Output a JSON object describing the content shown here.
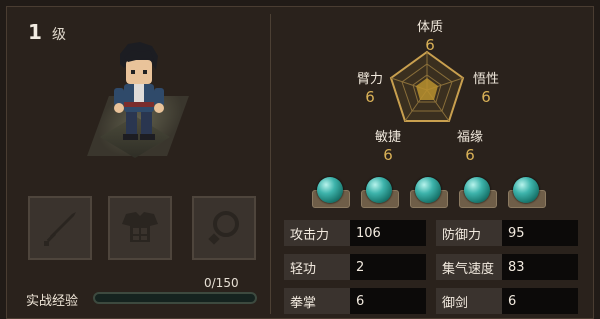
{
  "level": {
    "number": "1",
    "unit": "级"
  },
  "equipment_slots": [
    {
      "name": "weapon",
      "icon": "sword-icon"
    },
    {
      "name": "armor",
      "icon": "armor-icon"
    },
    {
      "name": "accessory",
      "icon": "necklace-icon"
    }
  ],
  "experience": {
    "label": "实战经验",
    "value": "0/150",
    "progress": 0.0
  },
  "attributes": {
    "tizhi": {
      "name": "体质",
      "value": "6"
    },
    "wuxing": {
      "name": "悟性",
      "value": "6"
    },
    "fuyuan": {
      "name": "福缘",
      "value": "6"
    },
    "minjie": {
      "name": "敏捷",
      "value": "6"
    },
    "bili": {
      "name": "臂力",
      "value": "6"
    }
  },
  "gems": {
    "count": 5,
    "color": "#3eb4ac"
  },
  "stats": [
    {
      "label": "攻击力",
      "value": "106"
    },
    {
      "label": "防御力",
      "value": "95"
    },
    {
      "label": "轻功",
      "value": "2"
    },
    {
      "label": "集气速度",
      "value": "83"
    },
    {
      "label": "拳掌",
      "value": "6"
    },
    {
      "label": "御剑",
      "value": "6"
    }
  ],
  "colors": {
    "accent": "#d9b157",
    "exp_fill": "#4e8a78",
    "gem": "#3eb4ac"
  }
}
